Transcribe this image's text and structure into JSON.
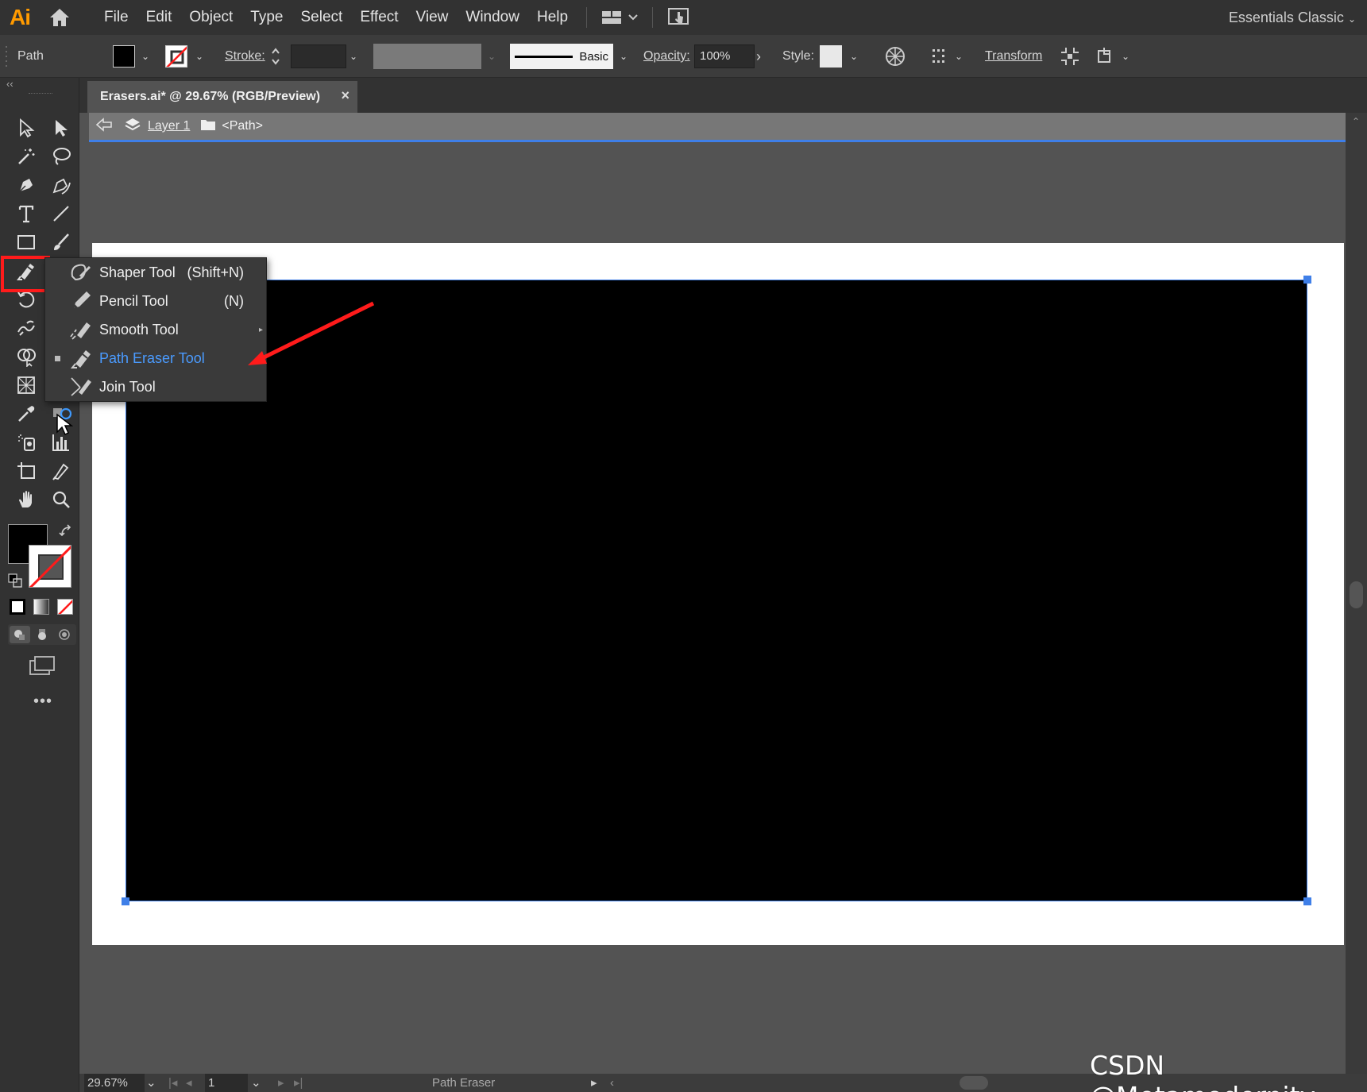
{
  "app": {
    "logo": "Ai",
    "workspace": "Essentials Classic"
  },
  "menu": [
    "File",
    "Edit",
    "Object",
    "Type",
    "Select",
    "Effect",
    "View",
    "Window",
    "Help"
  ],
  "control_bar": {
    "selection_type": "Path",
    "stroke_label": "Stroke:",
    "brush_label": "Basic",
    "opacity_label": "Opacity:",
    "opacity_value": "100%",
    "style_label": "Style:",
    "transform_label": "Transform"
  },
  "document": {
    "tab_title": "Erasers.ai* @ 29.67% (RGB/Preview)",
    "close_glyph": "×",
    "breadcrumb_layer": "Layer 1",
    "breadcrumb_object": "<Path>"
  },
  "flyout": {
    "items": [
      {
        "label": "Shaper Tool",
        "shortcut": "(Shift+N)",
        "icon": "shaper-icon"
      },
      {
        "label": "Pencil Tool",
        "shortcut": "(N)",
        "icon": "pencil-icon"
      },
      {
        "label": "Smooth Tool",
        "shortcut": "",
        "icon": "smooth-icon"
      },
      {
        "label": "Path Eraser Tool",
        "shortcut": "",
        "icon": "path-eraser-icon",
        "active": true
      },
      {
        "label": "Join Tool",
        "shortcut": "",
        "icon": "join-icon"
      }
    ]
  },
  "status_bar": {
    "zoom": "29.67%",
    "artboard_number": "1",
    "tool_name": "Path Eraser"
  },
  "watermark": "CSDN @Metamodernity",
  "colors": {
    "accent": "#3f7fe8",
    "highlight_red": "#ff1b1b",
    "active_item": "#4a9bff",
    "logo": "#ff9a00"
  }
}
